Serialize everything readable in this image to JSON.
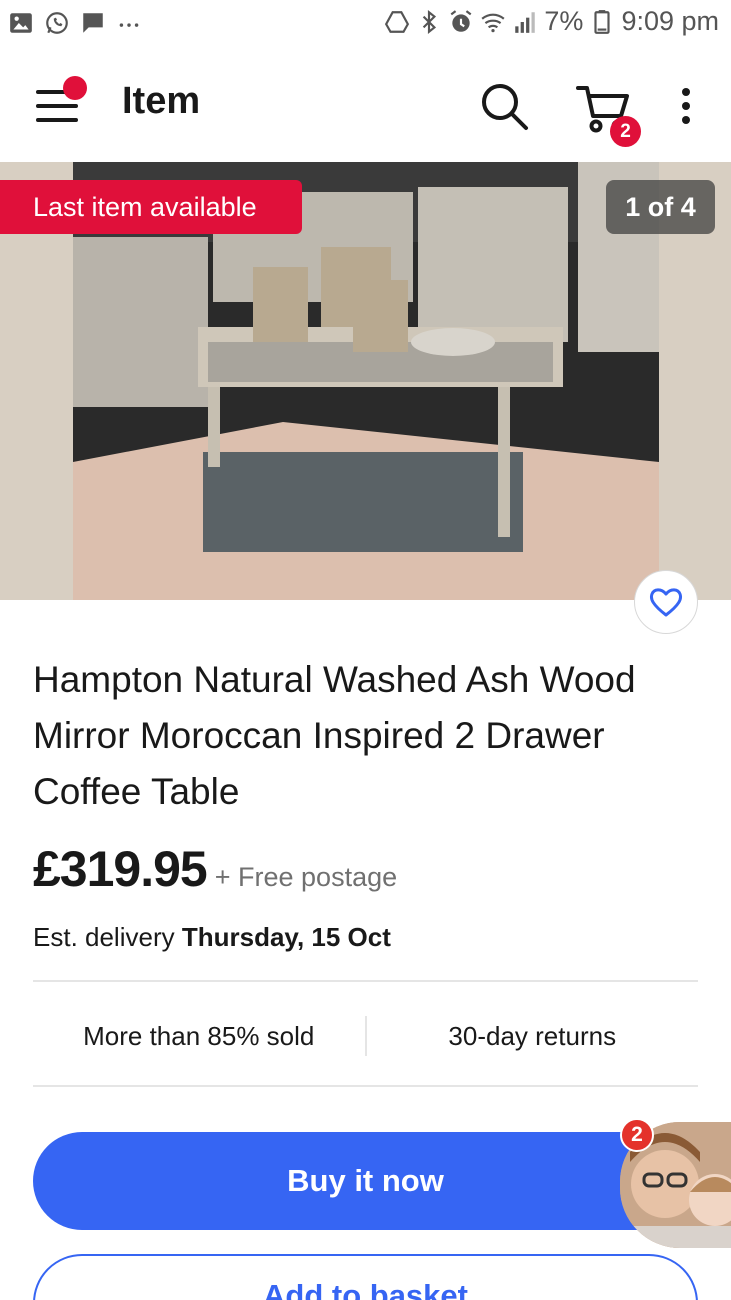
{
  "status_bar": {
    "battery": "7%",
    "time": "9:09 pm",
    "icons": [
      "gallery-icon",
      "whatsapp-icon",
      "message-icon",
      "more-notifications-icon",
      "drive-icon",
      "bluetooth-icon",
      "alarm-icon",
      "wifi-icon",
      "signal-icon",
      "battery-icon"
    ]
  },
  "app_bar": {
    "title": "Item",
    "cart_count": "2"
  },
  "gallery": {
    "badge": "Last item available",
    "counter": "1 of 4"
  },
  "product": {
    "title": "Hampton Natural Washed Ash Wood Mirror Moroccan Inspired 2 Drawer Coffee Table",
    "price": "£319.95",
    "postage": "+ Free postage",
    "delivery_prefix": "Est. delivery",
    "delivery_date": "Thursday, 15 Oct"
  },
  "stats": {
    "sold": "More than 85% sold",
    "returns": "30-day returns"
  },
  "actions": {
    "buy": "Buy it now",
    "basket": "Add to basket"
  },
  "chat_head": {
    "count": "2"
  },
  "colors": {
    "accent_red": "#e0103a",
    "primary_blue": "#3665f3"
  }
}
